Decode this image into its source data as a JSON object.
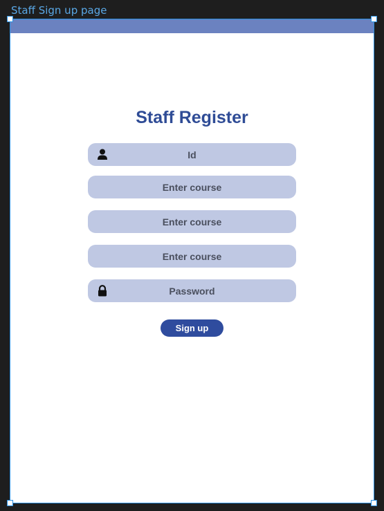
{
  "frame": {
    "label": "Staff Sign up page"
  },
  "form": {
    "title": "Staff Register",
    "fields": [
      {
        "label": "Id",
        "icon": "user-icon"
      },
      {
        "label": "Enter course"
      },
      {
        "label": "Enter course"
      },
      {
        "label": "Enter course"
      },
      {
        "label": "Password",
        "icon": "lock-icon"
      }
    ],
    "submit_label": "Sign up"
  },
  "colors": {
    "accent": "#2f4c9e",
    "field_bg": "#bfc8e3",
    "topbar": "#6b82c0",
    "selection": "#2a8fe0"
  }
}
